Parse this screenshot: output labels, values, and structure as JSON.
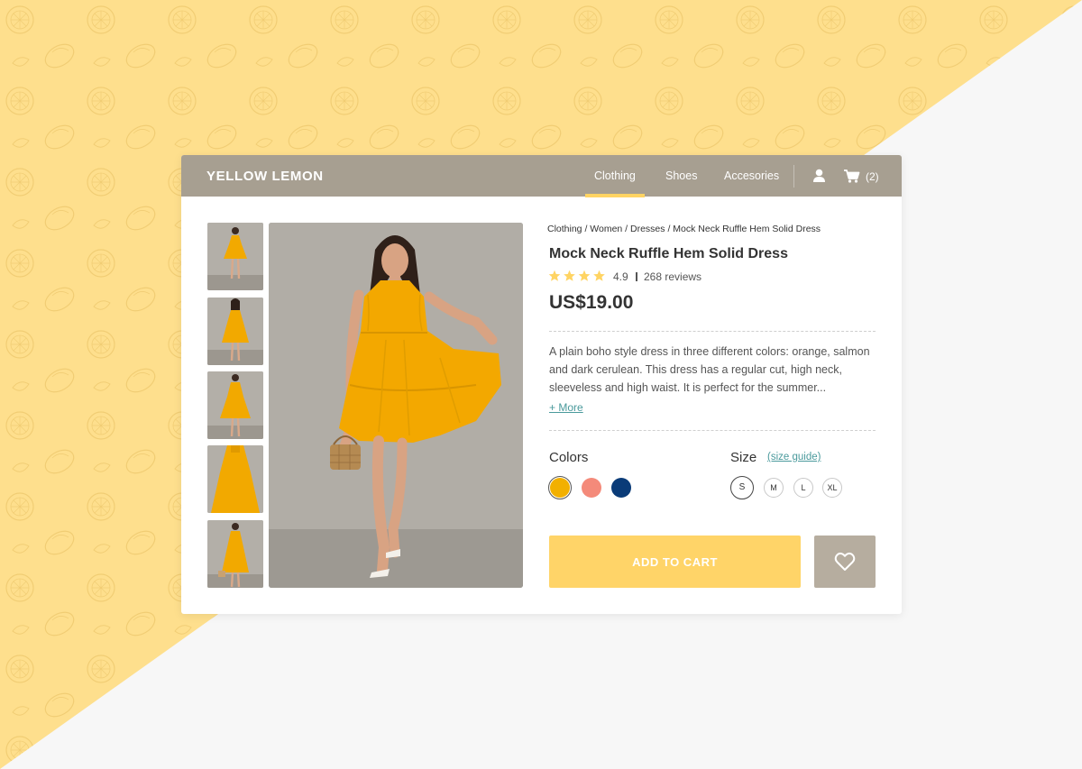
{
  "brand": "YELLOW LEMON",
  "nav": {
    "items": [
      "Clothing",
      "Shoes",
      "Accesories"
    ],
    "cart_count": "(2)"
  },
  "breadcrumb": "Clothing / Women / Dresses / Mock Neck Ruffle Hem Solid Dress",
  "product": {
    "title": "Mock Neck Ruffle Hem Solid Dress",
    "rating": "4.9",
    "stars": 4,
    "reviews": "268 reviews",
    "price": "US$19.00",
    "description": "A plain boho style dress in three different colors: orange, salmon and dark cerulean. This dress has a regular cut, high neck, sleeveless and high waist. It is perfect for the summer...",
    "more": "+ More"
  },
  "colors": {
    "label": "Colors",
    "options": [
      "#f2b000",
      "#f48a7a",
      "#0a3b78"
    ],
    "selected": 0
  },
  "size": {
    "label": "Size",
    "guide": "(size guide)",
    "options": [
      "S",
      "M",
      "L",
      "XL"
    ],
    "selected": "S"
  },
  "actions": {
    "add_to_cart": "ADD TO CART"
  },
  "theme": {
    "topbar": "#a79f91",
    "accent": "#ffd463",
    "link": "#4a9a9c",
    "background_yellow": "#fedf8d"
  }
}
